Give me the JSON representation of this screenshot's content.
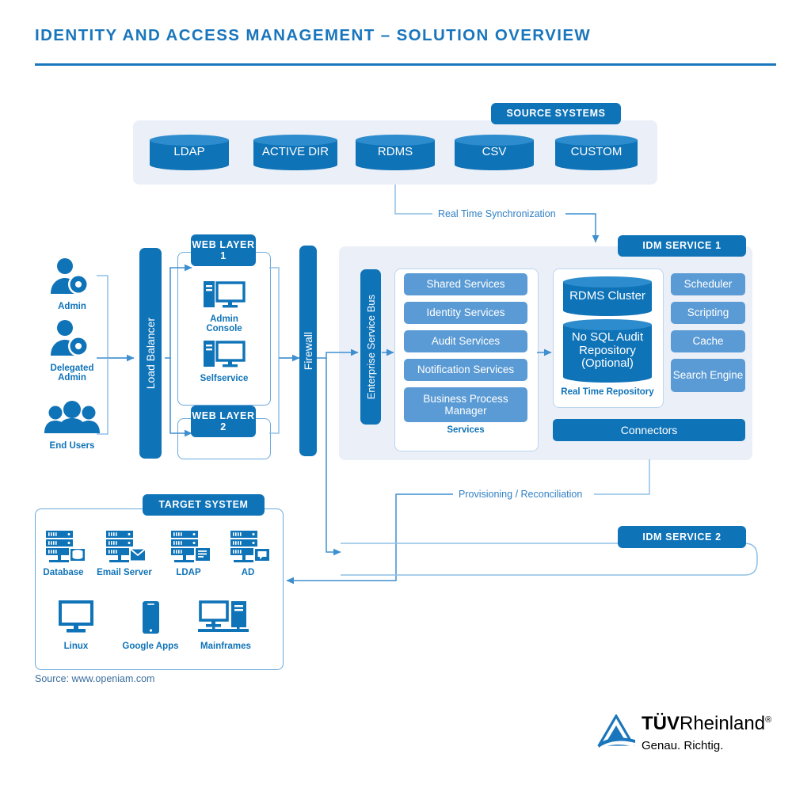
{
  "page": {
    "title": "IDENTITY AND ACCESS MANAGEMENT – SOLUTION OVERVIEW",
    "source_note": "Source: www.openiam.com",
    "accent_color": "#1a76bc",
    "primary_blue": "#0f73b8",
    "light_blue": "#5b9bd5",
    "panel_bg": "#eaeff8"
  },
  "source_systems": {
    "label": "SOURCE SYSTEMS",
    "items": [
      {
        "label": "LDAP"
      },
      {
        "label": "ACTIVE DIR"
      },
      {
        "label": "RDMS"
      },
      {
        "label": "CSV"
      },
      {
        "label": "CUSTOM"
      }
    ]
  },
  "actors": [
    {
      "label": "Admin",
      "icon": "user-gear-icon"
    },
    {
      "label": "Delegated Admin",
      "icon": "user-gear-icon"
    },
    {
      "label": "End Users",
      "icon": "users-group-icon"
    }
  ],
  "load_balancer": {
    "label": "Load Balancer"
  },
  "firewall": {
    "label": "Firewall"
  },
  "web_layer_1": {
    "label": "WEB LAYER 1",
    "nodes": [
      {
        "label": "Admin Console",
        "icon": "desktop-tower-icon"
      },
      {
        "label": "Selfservice",
        "icon": "desktop-tower-icon"
      }
    ]
  },
  "web_layer_2": {
    "label": "WEB LAYER 2"
  },
  "idm_service_1": {
    "label": "IDM SERVICE 1",
    "esb": {
      "label": "Enterprise Service Bus"
    },
    "services": {
      "caption": "Services",
      "items": [
        {
          "label": "Shared Services"
        },
        {
          "label": "Identity Services"
        },
        {
          "label": "Audit Services"
        },
        {
          "label": "Notification Services"
        },
        {
          "label": "Business Process Manager"
        }
      ]
    },
    "repository": {
      "caption": "Real Time Repository",
      "items": [
        {
          "label": "RDMS Cluster"
        },
        {
          "label": "No SQL Audit Repository (Optional)"
        }
      ]
    },
    "right_modules": [
      {
        "label": "Scheduler"
      },
      {
        "label": "Scripting"
      },
      {
        "label": "Cache"
      },
      {
        "label": "Search Engine"
      }
    ],
    "connectors": {
      "label": "Connectors"
    }
  },
  "idm_service_2": {
    "label": "IDM SERVICE 2"
  },
  "target_system": {
    "label": "TARGET SYSTEM",
    "row1": [
      {
        "label": "Database",
        "icon": "server-database-icon"
      },
      {
        "label": "Email Server",
        "icon": "server-mail-icon"
      },
      {
        "label": "LDAP",
        "icon": "server-document-icon"
      },
      {
        "label": "AD",
        "icon": "server-chat-icon"
      }
    ],
    "row2": [
      {
        "label": "Linux",
        "icon": "monitor-icon"
      },
      {
        "label": "Google Apps",
        "icon": "smartphone-icon"
      },
      {
        "label": "Mainframes",
        "icon": "monitor-tower-icon"
      }
    ]
  },
  "flow_labels": {
    "sync": "Real Time Synchronization",
    "provisioning": "Provisioning / Reconciliation"
  },
  "logo": {
    "bold_part": "TÜV",
    "light_part": "Rheinland",
    "registered": "®",
    "tagline": "Genau. Richtig."
  }
}
